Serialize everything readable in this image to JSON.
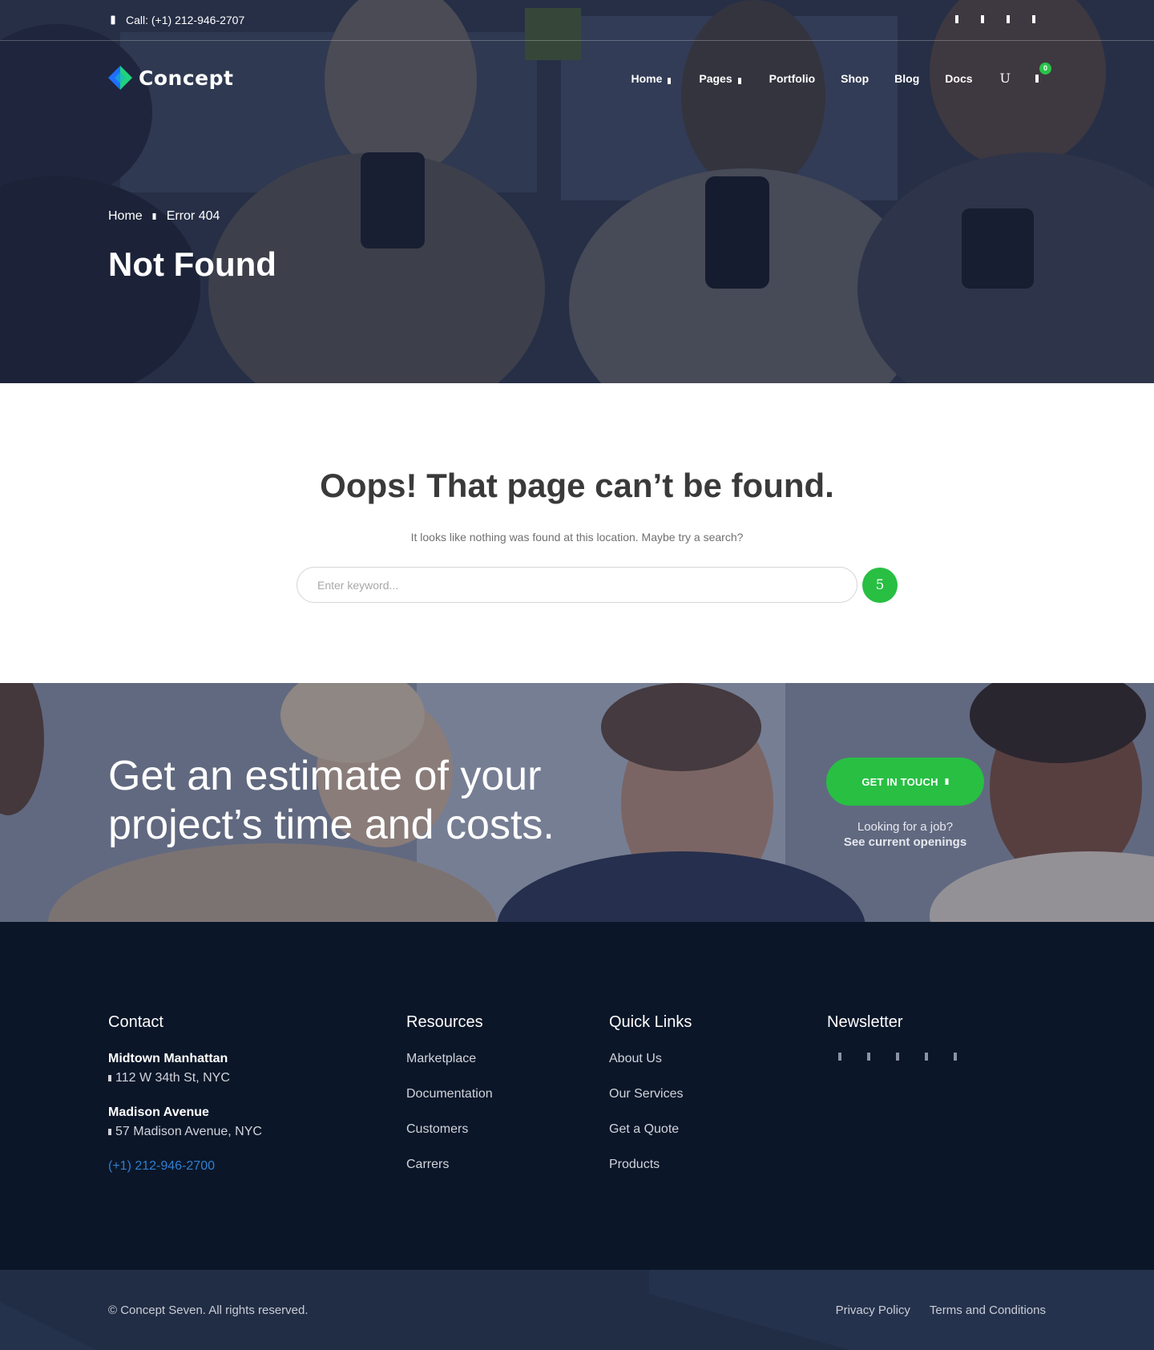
{
  "topbar": {
    "phone": "Call: (+1) 212-946-2707",
    "socials": [
      "facebook-icon",
      "twitter-icon",
      "instagram-icon",
      "linkedin-icon"
    ]
  },
  "brand": {
    "name": "Concept",
    "colors": {
      "accent": "#28bf43",
      "link": "#2f7fd1",
      "dark": "#0b1628"
    }
  },
  "nav": {
    "items": [
      {
        "label": "Home",
        "has_dropdown": true
      },
      {
        "label": "Pages",
        "has_dropdown": true
      },
      {
        "label": "Portfolio",
        "has_dropdown": false
      },
      {
        "label": "Shop",
        "has_dropdown": false
      },
      {
        "label": "Blog",
        "has_dropdown": false
      },
      {
        "label": "Docs",
        "has_dropdown": false
      }
    ],
    "user_glyph": "U",
    "cart_count": "0"
  },
  "hero": {
    "breadcrumb": {
      "home": "Home",
      "current": "Error 404"
    },
    "title": "Not Found"
  },
  "main": {
    "heading": "Oops! That page can’t be found.",
    "subtitle": "It looks like nothing was found at this location. Maybe try a search?",
    "search": {
      "placeholder": "Enter keyword...",
      "button_glyph": "5"
    }
  },
  "cta": {
    "heading": "Get an estimate of your project’s time and costs.",
    "button": "GET IN TOUCH",
    "job_text": "Looking for a job?",
    "job_link": "See current openings"
  },
  "footer": {
    "contact": {
      "title": "Contact",
      "locations": [
        {
          "name": "Midtown Manhattan",
          "address": "112 W 34th St, NYC"
        },
        {
          "name": "Madison Avenue",
          "address": "57 Madison Avenue, NYC"
        }
      ],
      "phone": "(+1) 212-946-2700"
    },
    "resources": {
      "title": "Resources",
      "links": [
        "Marketplace",
        "Documentation",
        "Customers",
        "Carrers"
      ]
    },
    "quick_links": {
      "title": "Quick Links",
      "links": [
        "About Us",
        "Our Services",
        "Get a Quote",
        "Products"
      ]
    },
    "newsletter": {
      "title": "Newsletter",
      "icons": [
        "facebook-icon",
        "twitter-icon",
        "instagram-icon",
        "linkedin-icon",
        "youtube-icon"
      ]
    }
  },
  "bottom": {
    "copyright": "© Concept Seven. All rights reserved.",
    "links": [
      "Privacy Policy",
      "Terms and Conditions"
    ]
  }
}
